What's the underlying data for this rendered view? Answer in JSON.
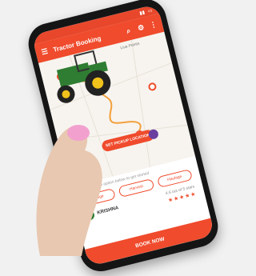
{
  "appbar": {
    "title": "Tractor Booking"
  },
  "map": {
    "pickup_label": "Live Points",
    "action_label": "SET PICKUP LOCATION"
  },
  "options": {
    "hint": "Select an option below to get started",
    "items": [
      "Tillage",
      "Harvest",
      "Haulage"
    ]
  },
  "driver": {
    "name": "KRISHNA"
  },
  "rating": {
    "label": "4.6 out of 5 stars"
  },
  "book": {
    "label": "BOOK NOW"
  },
  "colors": {
    "accent": "#ef4b2c",
    "tractor_green": "#2f7d32",
    "tractor_yellow": "#f1c21b"
  },
  "icons": {
    "menu": "hamburger-menu-icon",
    "search": "search-icon",
    "settings": "gear-icon",
    "more": "more-vert-icon"
  }
}
